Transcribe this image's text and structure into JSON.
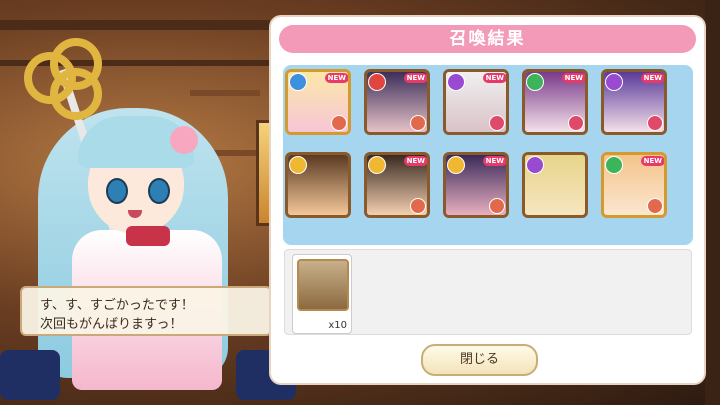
{
  "title": "召喚結果",
  "dialog": {
    "line1": "す、す、すごかったです！",
    "line2": "次回もがんばりますっ！"
  },
  "results": [
    {
      "element": "water",
      "element_color": "#3d8fe0",
      "rarity": "gold",
      "new": "NEW",
      "role_color": "#e26a4c",
      "art": [
        "#fbe7a8",
        "#f7c6d6"
      ]
    },
    {
      "element": "fire",
      "element_color": "#e0463d",
      "rarity": "bronze",
      "new": "NEW",
      "role_color": "#e26a4c",
      "art": [
        "#3c2f5a",
        "#e6c2c7"
      ]
    },
    {
      "element": "dark",
      "element_color": "#9a4ad0",
      "rarity": "bronze",
      "new": "NEW",
      "role_color": "#e04a6a",
      "art": [
        "#f0f0f0",
        "#d9c2c8"
      ]
    },
    {
      "element": "wind",
      "element_color": "#3bb45a",
      "rarity": "bronze",
      "new": "NEW",
      "role_color": "#e04a6a",
      "art": [
        "#7a3a8a",
        "#f3e2ea"
      ]
    },
    {
      "element": "dark",
      "element_color": "#9a4ad0",
      "rarity": "bronze",
      "new": "NEW",
      "role_color": "#e04a6a",
      "art": [
        "#5a3a9a",
        "#f3e0e8"
      ]
    },
    {
      "element": "light",
      "element_color": "#f0b830",
      "rarity": "bronze",
      "new": "",
      "role_color": "",
      "art": [
        "#5a3a22",
        "#f4c79a"
      ]
    },
    {
      "element": "light",
      "element_color": "#f0b830",
      "rarity": "bronze",
      "new": "NEW",
      "role_color": "#e26a4c",
      "art": [
        "#3a2a22",
        "#f4d0b0"
      ]
    },
    {
      "element": "light",
      "element_color": "#f0b830",
      "rarity": "bronze",
      "new": "NEW",
      "role_color": "#e26a4c",
      "art": [
        "#3a2a5a",
        "#e8b0c0"
      ]
    },
    {
      "element": "dark",
      "element_color": "#9a4ad0",
      "rarity": "bronze",
      "new": "",
      "role_color": "",
      "art": [
        "#e7d48a",
        "#f6e6c0"
      ]
    },
    {
      "element": "wind",
      "element_color": "#3bb45a",
      "rarity": "gold",
      "new": "NEW",
      "role_color": "#e26a4c",
      "art": [
        "#f4c48a",
        "#fbe6d0"
      ]
    }
  ],
  "items": [
    {
      "name": "memory-crystal-icon",
      "count": "x10"
    }
  ],
  "close_label": "閉じる"
}
